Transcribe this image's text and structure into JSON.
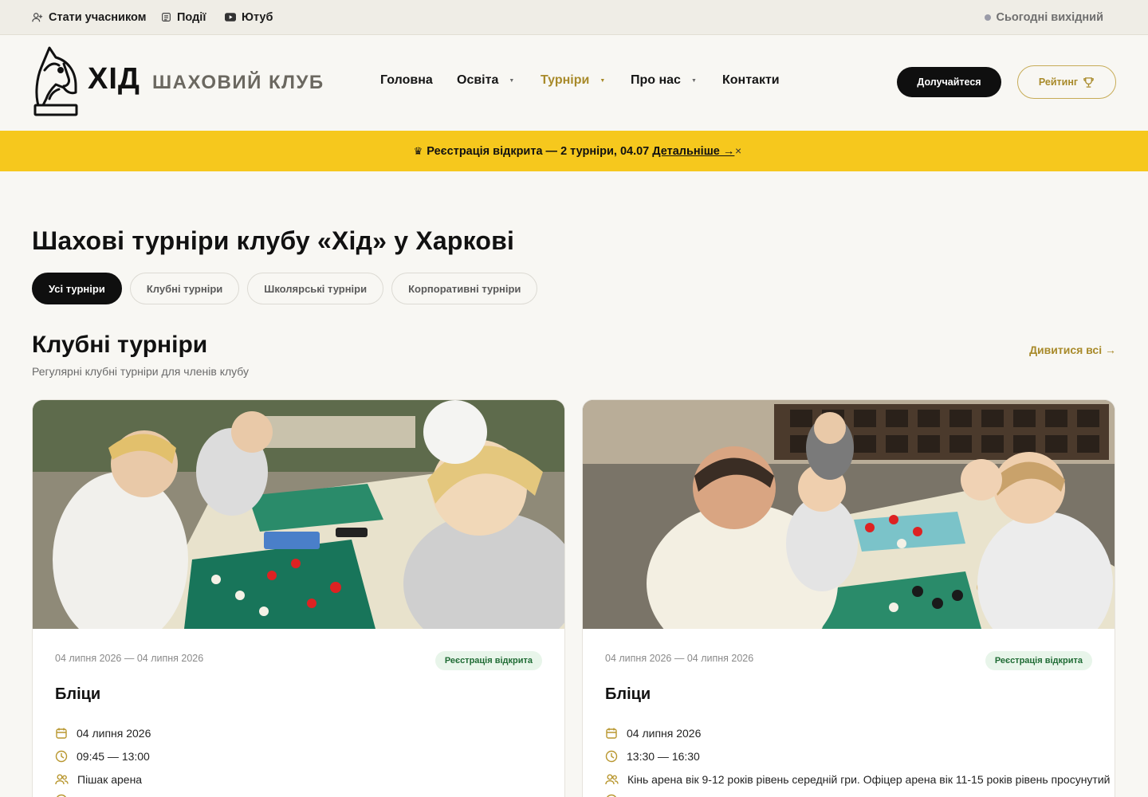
{
  "topbar": {
    "become_member": "Стати учасником",
    "events": "Події",
    "youtube": "Ютуб",
    "status": "Сьогодні вихідний"
  },
  "header": {
    "logo_main": "ХІД",
    "logo_sub": "ШАХОВИЙ КЛУБ",
    "nav": [
      "Головна",
      "Освіта",
      "Турніри",
      "Про нас",
      "Контакти"
    ],
    "join_button": "Долучайтеся",
    "rating_button": "Рейтинг"
  },
  "banner": {
    "text": "Реєстрація відкрита — 2 турніри, 04.07",
    "link": "Детальніше →",
    "close": "×"
  },
  "main": {
    "title": "Шахові турніри клубу «Хід» у Харкові",
    "filters": [
      "Усі турніри",
      "Клубні турніри",
      "Школярські турніри",
      "Корпоративні турніри"
    ],
    "section_title": "Клубні турніри",
    "section_subtitle": "Регулярні клубні турніри для членів клубу",
    "see_all": "Дивитися всі →"
  },
  "cards": [
    {
      "dates": "04 липня 2026 — 04 липня 2026",
      "badge": "Реєстрація відкрита",
      "title": "Бліци",
      "date": "04 липня 2026",
      "time": "09:45 — 13:00",
      "place": "Пішак арена"
    },
    {
      "dates": "04 липня 2026 — 04 липня 2026",
      "badge": "Реєстрація відкрита",
      "title": "Бліци",
      "date": "04 липня 2026",
      "time": "13:30 — 16:30",
      "place": "Кінь арена вік 9-12 років рівень середній гри. Офіцер арена вік 11-15 років рівень просунутий"
    }
  ],
  "colors": {
    "accent_gold": "#a88a2a",
    "banner_yellow": "#f6c81d",
    "dark": "#0f0f0f",
    "badge_green": "#1f6b34"
  }
}
